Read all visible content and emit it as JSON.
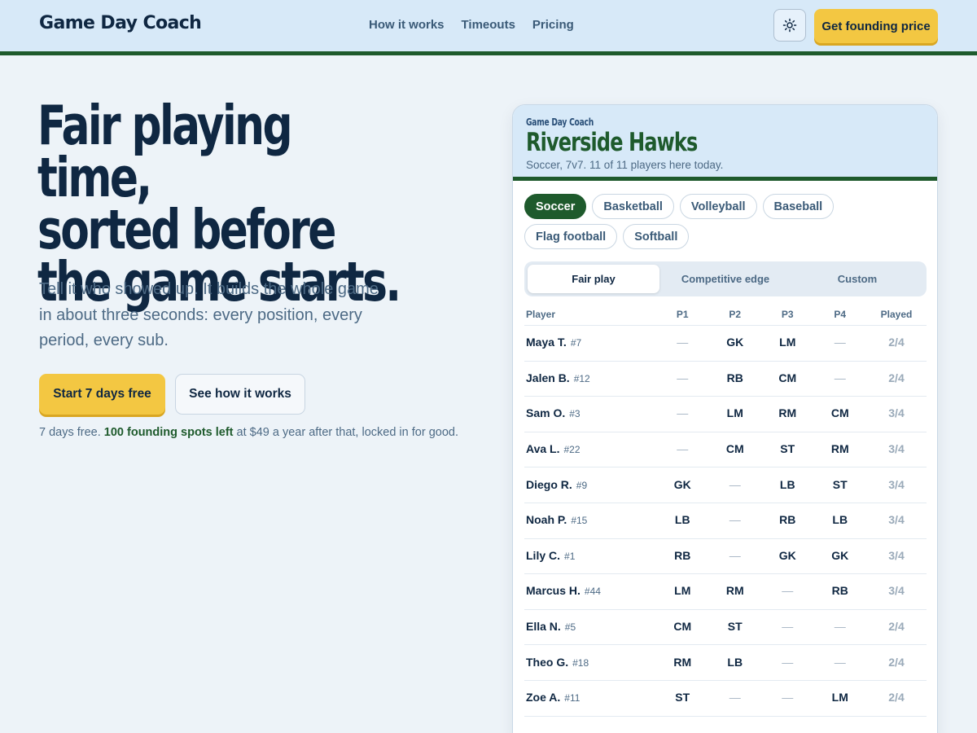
{
  "header": {
    "brand": "Game Day Coach",
    "nav": [
      "How it works",
      "Timeouts",
      "Pricing"
    ],
    "theme_icon": "sun-icon",
    "cta": "Get founding price"
  },
  "hero": {
    "headline": [
      "Fair playing time,",
      "sorted before",
      "the game starts."
    ],
    "subcopy": "Tell it who showed up. It builds the whole game in about three seconds: every position, every period, every sub.",
    "primary_button": "Start 7 days free",
    "secondary_button": "See how it works",
    "footnote_pre": "7 days free.",
    "footnote_highlight": "100 founding spots left",
    "footnote_post": "at $49 a year after that, locked in for good."
  },
  "card": {
    "kicker": "Game Day Coach",
    "team": "Riverside Hawks",
    "subtitle": "Soccer, 7v7. 11 of 11 players here today.",
    "sports": [
      "Soccer",
      "Basketball",
      "Volleyball",
      "Baseball",
      "Flag football",
      "Softball"
    ],
    "selected_sport": "Soccer",
    "modes": [
      "Fair play",
      "Competitive edge",
      "Custom"
    ],
    "selected_mode": "Fair play",
    "columns": [
      "Player",
      "P1",
      "P2",
      "P3",
      "P4",
      "Played"
    ],
    "rows": [
      {
        "name": "Maya T.",
        "num": "#7",
        "p": [
          "—",
          "GK",
          "LM",
          "—"
        ],
        "played": "2/4"
      },
      {
        "name": "Jalen B.",
        "num": "#12",
        "p": [
          "—",
          "RB",
          "CM",
          "—"
        ],
        "played": "2/4"
      },
      {
        "name": "Sam O.",
        "num": "#3",
        "p": [
          "—",
          "LM",
          "RM",
          "CM"
        ],
        "played": "3/4"
      },
      {
        "name": "Ava L.",
        "num": "#22",
        "p": [
          "—",
          "CM",
          "ST",
          "RM"
        ],
        "played": "3/4"
      },
      {
        "name": "Diego R.",
        "num": "#9",
        "p": [
          "GK",
          "—",
          "LB",
          "ST"
        ],
        "played": "3/4"
      },
      {
        "name": "Noah P.",
        "num": "#15",
        "p": [
          "LB",
          "—",
          "RB",
          "LB"
        ],
        "played": "3/4"
      },
      {
        "name": "Lily C.",
        "num": "#1",
        "p": [
          "RB",
          "—",
          "GK",
          "GK"
        ],
        "played": "3/4"
      },
      {
        "name": "Marcus H.",
        "num": "#44",
        "p": [
          "LM",
          "RM",
          "—",
          "RB"
        ],
        "played": "3/4"
      },
      {
        "name": "Ella N.",
        "num": "#5",
        "p": [
          "CM",
          "ST",
          "—",
          "—"
        ],
        "played": "2/4"
      },
      {
        "name": "Theo G.",
        "num": "#18",
        "p": [
          "RM",
          "LB",
          "—",
          "—"
        ],
        "played": "2/4"
      },
      {
        "name": "Zoe A.",
        "num": "#11",
        "p": [
          "ST",
          "—",
          "—",
          "LM"
        ],
        "played": "2/4"
      }
    ]
  },
  "colors": {
    "navy": "#0f2742",
    "green": "#1e5a2c",
    "yellow": "#f3c742",
    "header_bg": "#d7e9f8",
    "page_bg": "#edf3f8"
  }
}
